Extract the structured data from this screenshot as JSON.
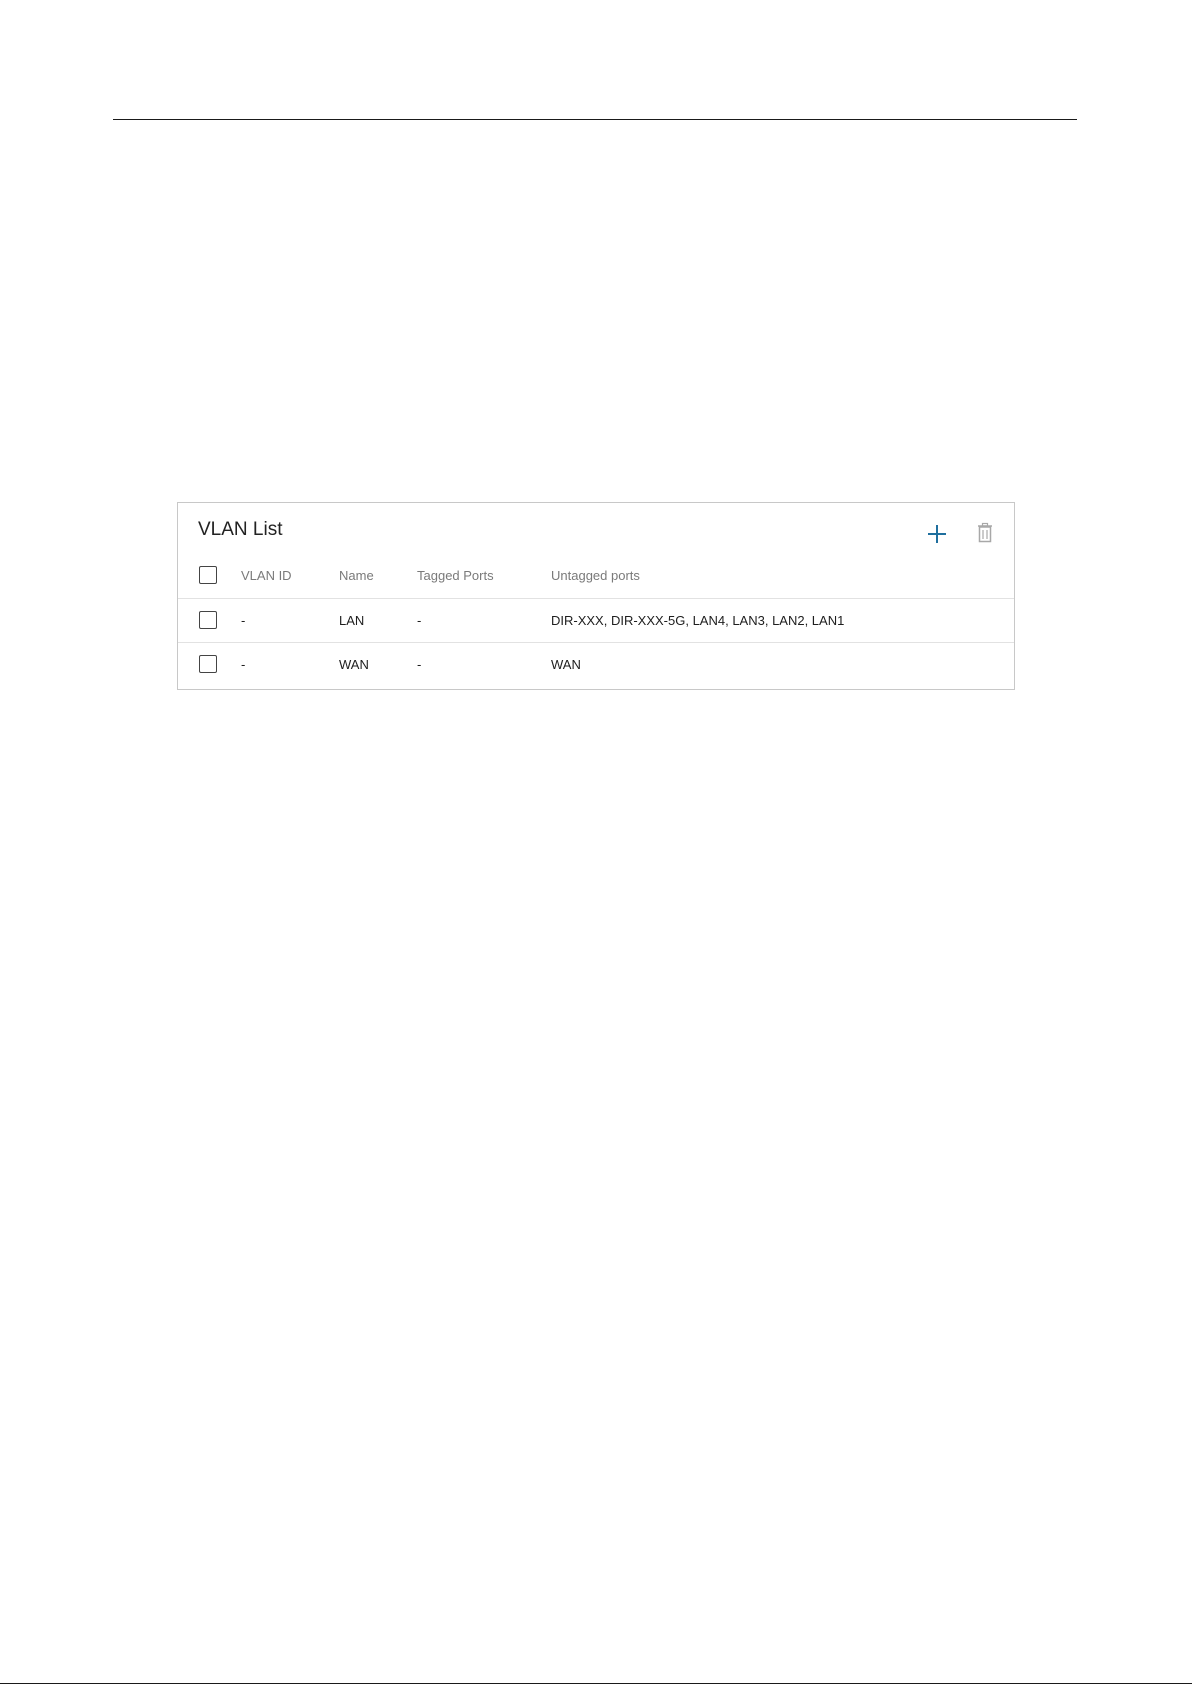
{
  "panel": {
    "title": "VLAN List",
    "add_icon": "plus-icon",
    "delete_icon": "trash-icon",
    "accent_color": "#1f6f9e",
    "muted_icon_color": "#a8a8a8"
  },
  "table": {
    "columns": [
      "VLAN ID",
      "Name",
      "Tagged Ports",
      "Untagged ports"
    ],
    "rows": [
      {
        "vlan_id": "-",
        "name": "LAN",
        "tagged": "-",
        "untagged": "DIR-XXX, DIR-XXX-5G, LAN4, LAN3, LAN2, LAN1"
      },
      {
        "vlan_id": "-",
        "name": "WAN",
        "tagged": "-",
        "untagged": "WAN"
      }
    ]
  }
}
